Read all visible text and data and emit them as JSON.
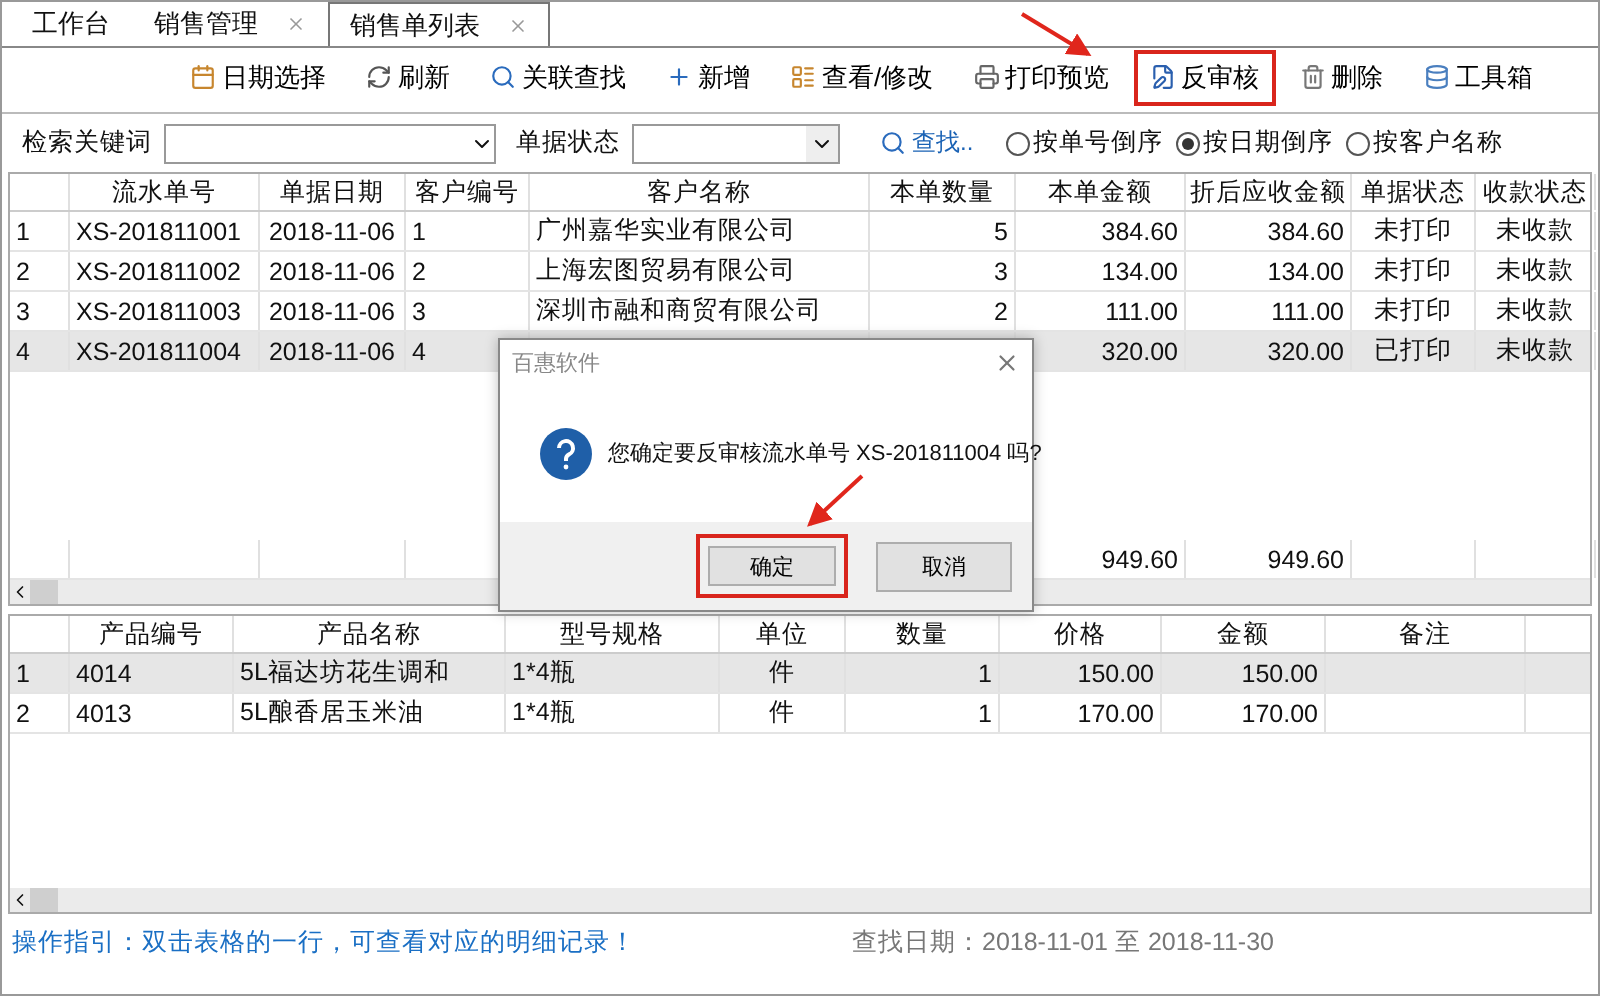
{
  "tabs": [
    {
      "label": "工作台",
      "selected": false,
      "closable": false
    },
    {
      "label": "销售管理",
      "selected": false,
      "closable": true
    },
    {
      "label": "销售单列表",
      "selected": true,
      "closable": true
    }
  ],
  "toolbar": [
    {
      "label": "日期选择",
      "kind": "calendar",
      "highlighted": false
    },
    {
      "label": "刷新",
      "kind": "refresh",
      "highlighted": false
    },
    {
      "label": "关联查找",
      "kind": "search",
      "highlighted": false
    },
    {
      "label": "新增",
      "kind": "plus",
      "highlighted": false
    },
    {
      "label": "查看/修改",
      "kind": "form",
      "highlighted": false
    },
    {
      "label": "打印预览",
      "kind": "printer",
      "highlighted": false
    },
    {
      "label": "反审核",
      "kind": "edit",
      "highlighted": true
    },
    {
      "label": "删除",
      "kind": "trash",
      "highlighted": false
    },
    {
      "label": "工具箱",
      "kind": "database",
      "highlighted": false
    }
  ],
  "filter": {
    "keyword_label": "检索关键词",
    "status_label": "单据状态",
    "find_label": "查找..",
    "sort_options": [
      {
        "label": "按单号倒序",
        "selected": false
      },
      {
        "label": "按日期倒序",
        "selected": true
      },
      {
        "label": "按客户名称",
        "selected": false
      }
    ]
  },
  "orders": {
    "columns": [
      "流水单号",
      "单据日期",
      "客户编号",
      "客户名称",
      "本单数量",
      "本单金额",
      "折后应收金额",
      "单据状态",
      "收款状态"
    ],
    "rows": [
      {
        "number": "1",
        "selected": false,
        "cells": [
          "XS-201811001",
          "2018-11-06",
          "1",
          "广州嘉华实业有限公司",
          "5",
          "384.60",
          "384.60",
          "未打印",
          "未收款"
        ]
      },
      {
        "number": "2",
        "selected": false,
        "cells": [
          "XS-201811002",
          "2018-11-06",
          "2",
          "上海宏图贸易有限公司",
          "3",
          "134.00",
          "134.00",
          "未打印",
          "未收款"
        ]
      },
      {
        "number": "3",
        "selected": false,
        "cells": [
          "XS-201811003",
          "2018-11-06",
          "3",
          "深圳市融和商贸有限公司",
          "2",
          "111.00",
          "111.00",
          "未打印",
          "未收款"
        ]
      },
      {
        "number": "4",
        "selected": true,
        "cells": [
          "XS-201811004",
          "2018-11-06",
          "4",
          null,
          null,
          "320.00",
          "320.00",
          "已打印",
          "未收款"
        ]
      }
    ],
    "totals": {
      "amount": "949.60",
      "net_amount": "949.60"
    }
  },
  "dialog": {
    "title": "百惠软件",
    "message": "您确定要反审核流水单号 XS-201811004 吗?",
    "buttons": [
      {
        "label": "确定",
        "highlighted": true
      },
      {
        "label": "取消",
        "highlighted": false
      }
    ]
  },
  "details": {
    "columns": [
      "产品编号",
      "产品名称",
      "型号规格",
      "单位",
      "数量",
      "价格",
      "金额",
      "备注"
    ],
    "rows": [
      {
        "number": "1",
        "selected": true,
        "cells": [
          "4014",
          "5L福达坊花生调和",
          "1*4瓶",
          "件",
          "1",
          "150.00",
          "150.00",
          null
        ]
      },
      {
        "number": "2",
        "selected": false,
        "cells": [
          "4013",
          "5L酿香居玉米油",
          "1*4瓶",
          "件",
          "1",
          "170.00",
          "170.00",
          null
        ]
      }
    ]
  },
  "status_bar": {
    "hint": "操作指引：双击表格的一行，可查看对应的明细记录！",
    "date_range": "查找日期：2018-11-01 至 2018-11-30"
  }
}
